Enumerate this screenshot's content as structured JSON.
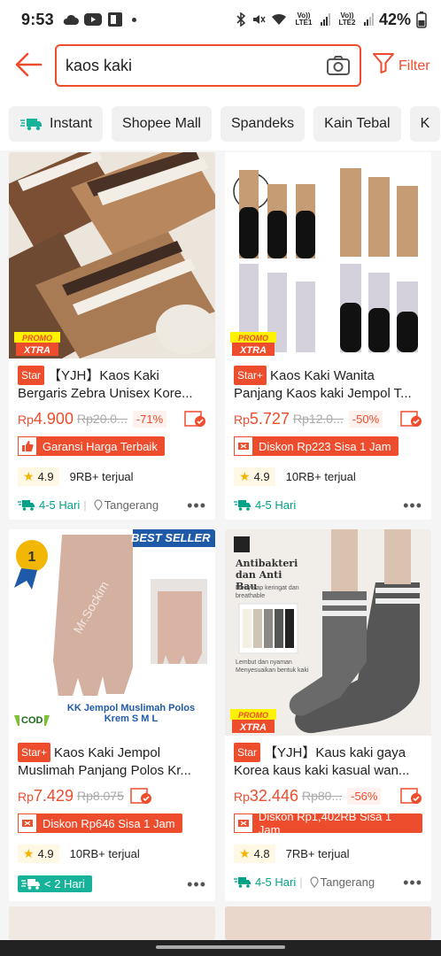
{
  "status": {
    "time": "9:53",
    "lte1": "Vo)) LTE1",
    "lte2": "Vo)) LTE2",
    "battery": "42%"
  },
  "search": {
    "query": "kaos kaki",
    "filter_label": "Filter"
  },
  "chips": [
    "Instant",
    "Shopee Mall",
    "Spandeks",
    "Kain Tebal",
    "K"
  ],
  "products": [
    {
      "tag": "Star",
      "title": "【YJH】Kaos Kaki Bergaris Zebra Unisex Kore...",
      "price_prefix": "Rp",
      "price": "4.900",
      "orig_price": "Rp20.0...",
      "discount": "-71%",
      "promo": "Garansi Harga Terbaik",
      "rating": "4.9",
      "sold": "9RB+ terjual",
      "shipping": "4-5 Hari",
      "location": "Tangerang",
      "image_badge": "PROMO XTRA"
    },
    {
      "tag": "Star+",
      "title": "Kaos Kaki Wanita Panjang Kaos kaki Jempol T...",
      "price_prefix": "Rp",
      "price": "5.727",
      "orig_price": "Rp12.0...",
      "discount": "-50%",
      "promo": "Diskon Rp223 Sisa 1 Jam",
      "rating": "4.9",
      "sold": "10RB+ terjual",
      "shipping": "4-5 Hari",
      "location": "",
      "image_badge": "PROMO XTRA"
    },
    {
      "tag": "Star+",
      "title": "Kaos Kaki Jempol Muslimah Panjang Polos Kr...",
      "price_prefix": "Rp",
      "price": "7.429",
      "orig_price": "Rp8.075",
      "discount": "",
      "promo": "Diskon Rp646 Sisa 1 Jam",
      "rating": "4.9",
      "sold": "10RB+ terjual",
      "shipping": "< 2 Hari",
      "location": "",
      "image_badge": "COD",
      "image_text": {
        "best_seller": "BEST SELLER",
        "caption": "KK Jempol Muslimah Polos Krem S M L",
        "watermark": "Mr.Sockim"
      }
    },
    {
      "tag": "Star",
      "title": "【YJH】Kaus kaki gaya Korea  kaus kaki kasual wan...",
      "price_prefix": "Rp",
      "price": "32.446",
      "orig_price": "Rp80...",
      "discount": "-56%",
      "promo": "Diskon Rp1,402RB Sisa 1 Jam",
      "rating": "4.8",
      "sold": "7RB+ terjual",
      "shipping": "4-5 Hari",
      "location": "Tangerang",
      "image_badge": "PROMO XTRA",
      "image_text": {
        "headline": "Antibakteri dan Anti Bau",
        "sub": "Menyerap keringat dan breathable",
        "note": "Lembut dan nyaman  Menyesuaikan bentuk kaki"
      }
    }
  ],
  "colors": {
    "brand": "#ee4d2d",
    "ship_green": "#00a388"
  }
}
